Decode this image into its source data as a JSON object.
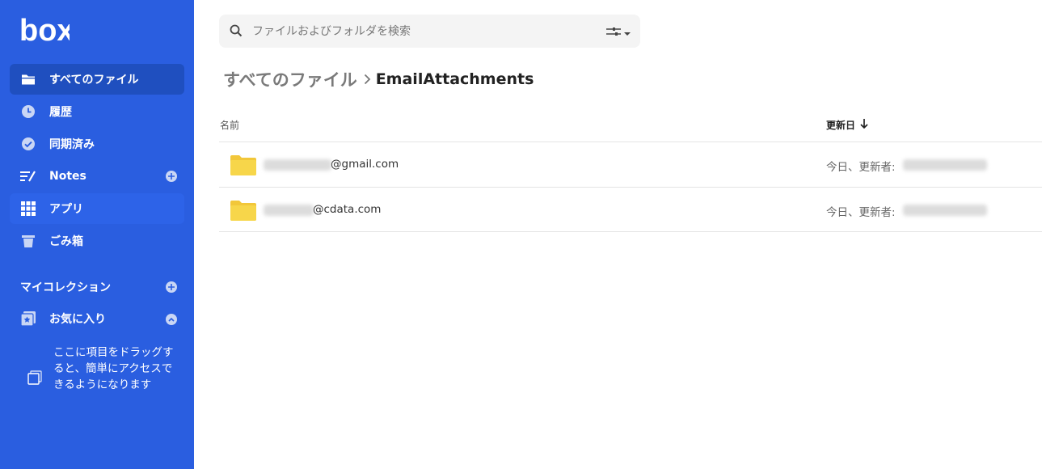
{
  "app": {
    "logo_text": "box"
  },
  "sidebar": {
    "items": [
      {
        "label": "すべてのファイル",
        "icon": "folder-icon",
        "active": true
      },
      {
        "label": "履歴",
        "icon": "clock-icon"
      },
      {
        "label": "同期済み",
        "icon": "check-circle-icon"
      },
      {
        "label": "Notes",
        "icon": "notes-icon",
        "has_add": true
      },
      {
        "label": "アプリ",
        "icon": "grid-icon",
        "hover": true
      },
      {
        "label": "ごみ箱",
        "icon": "trash-icon"
      }
    ],
    "collections_title": "マイコレクション",
    "favorites_label": "お気に入り",
    "favorites_hint": "ここに項目をドラッグすると、簡単にアクセスできるようになります"
  },
  "search": {
    "placeholder": "ファイルおよびフォルダを検索"
  },
  "breadcrumb": {
    "root": "すべてのファイル",
    "current": "EmailAttachments"
  },
  "table": {
    "columns": {
      "name": "名前",
      "modified": "更新日"
    },
    "rows": [
      {
        "name_suffix": "@gmail.com",
        "modified": "今日、更新者:"
      },
      {
        "name_suffix": "@cdata.com",
        "modified": "今日、更新者:"
      }
    ]
  },
  "colors": {
    "sidebar": "#2a5ee0",
    "active_item": "#1f4fbf",
    "folder": "#f7d64a"
  }
}
